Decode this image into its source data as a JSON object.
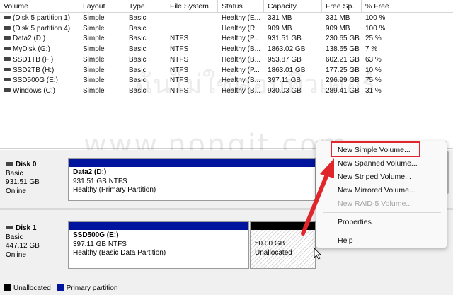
{
  "volume_table": {
    "columns": [
      "Volume",
      "Layout",
      "Type",
      "File System",
      "Status",
      "Capacity",
      "Free Sp...",
      "% Free"
    ],
    "rows": [
      [
        "(Disk 5 partition 1)",
        "Simple",
        "Basic",
        "",
        "Healthy (E...",
        "331 MB",
        "331 MB",
        "100 %"
      ],
      [
        "(Disk 5 partition 4)",
        "Simple",
        "Basic",
        "",
        "Healthy (R...",
        "909 MB",
        "909 MB",
        "100 %"
      ],
      [
        "Data2 (D:)",
        "Simple",
        "Basic",
        "NTFS",
        "Healthy (P...",
        "931.51 GB",
        "230.65 GB",
        "25 %"
      ],
      [
        "MyDisk (G:)",
        "Simple",
        "Basic",
        "NTFS",
        "Healthy (B...",
        "1863.02 GB",
        "138.65 GB",
        "7 %"
      ],
      [
        "SSD1TB (F:)",
        "Simple",
        "Basic",
        "NTFS",
        "Healthy (B...",
        "953.87 GB",
        "602.21 GB",
        "63 %"
      ],
      [
        "SSD2TB (H:)",
        "Simple",
        "Basic",
        "NTFS",
        "Healthy (P...",
        "1863.01 GB",
        "177.25 GB",
        "10 %"
      ],
      [
        "SSD500G (E:)",
        "Simple",
        "Basic",
        "NTFS",
        "Healthy (B...",
        "397.11 GB",
        "296.99 GB",
        "75 %"
      ],
      [
        "Windows (C:)",
        "Simple",
        "Basic",
        "NTFS",
        "Healthy (B...",
        "930.03 GB",
        "289.41 GB",
        "31 %"
      ]
    ]
  },
  "disks": [
    {
      "name": "Disk 0",
      "type": "Basic",
      "size": "931.51 GB",
      "state": "Online",
      "partition": {
        "name": "Data2  (D:)",
        "size_fs": "931.51 GB NTFS",
        "status": "Healthy (Primary Partition)"
      }
    },
    {
      "name": "Disk 1",
      "type": "Basic",
      "size": "447.12 GB",
      "state": "Online",
      "partition": {
        "name": "SSD500G  (E:)",
        "size_fs": "397.11 GB NTFS",
        "status": "Healthy (Basic Data Partition)"
      },
      "unallocated": {
        "size": "50.00 GB",
        "label": "Unallocated"
      }
    }
  ],
  "context_menu": {
    "items": [
      {
        "label": "New Simple Volume...",
        "enabled": true,
        "highlighted": true
      },
      {
        "label": "New Spanned Volume...",
        "enabled": true
      },
      {
        "label": "New Striped Volume...",
        "enabled": true
      },
      {
        "label": "New Mirrored Volume...",
        "enabled": true
      },
      {
        "label": "New RAID-5 Volume...",
        "enabled": false
      },
      {
        "label": "Properties",
        "enabled": true
      },
      {
        "label": "Help",
        "enabled": true
      }
    ]
  },
  "legend": {
    "unallocated_label": "Unallocated",
    "primary_label": "Primary partition"
  },
  "watermark": {
    "text": "www.nongit.com",
    "thai": "ฉันไม่ใช่คอมพิวเตอร์"
  },
  "colors": {
    "primary_partition": "#00149e",
    "unallocated": "#000000",
    "highlight_box": "#e0252b",
    "arrow": "#e0252b"
  }
}
